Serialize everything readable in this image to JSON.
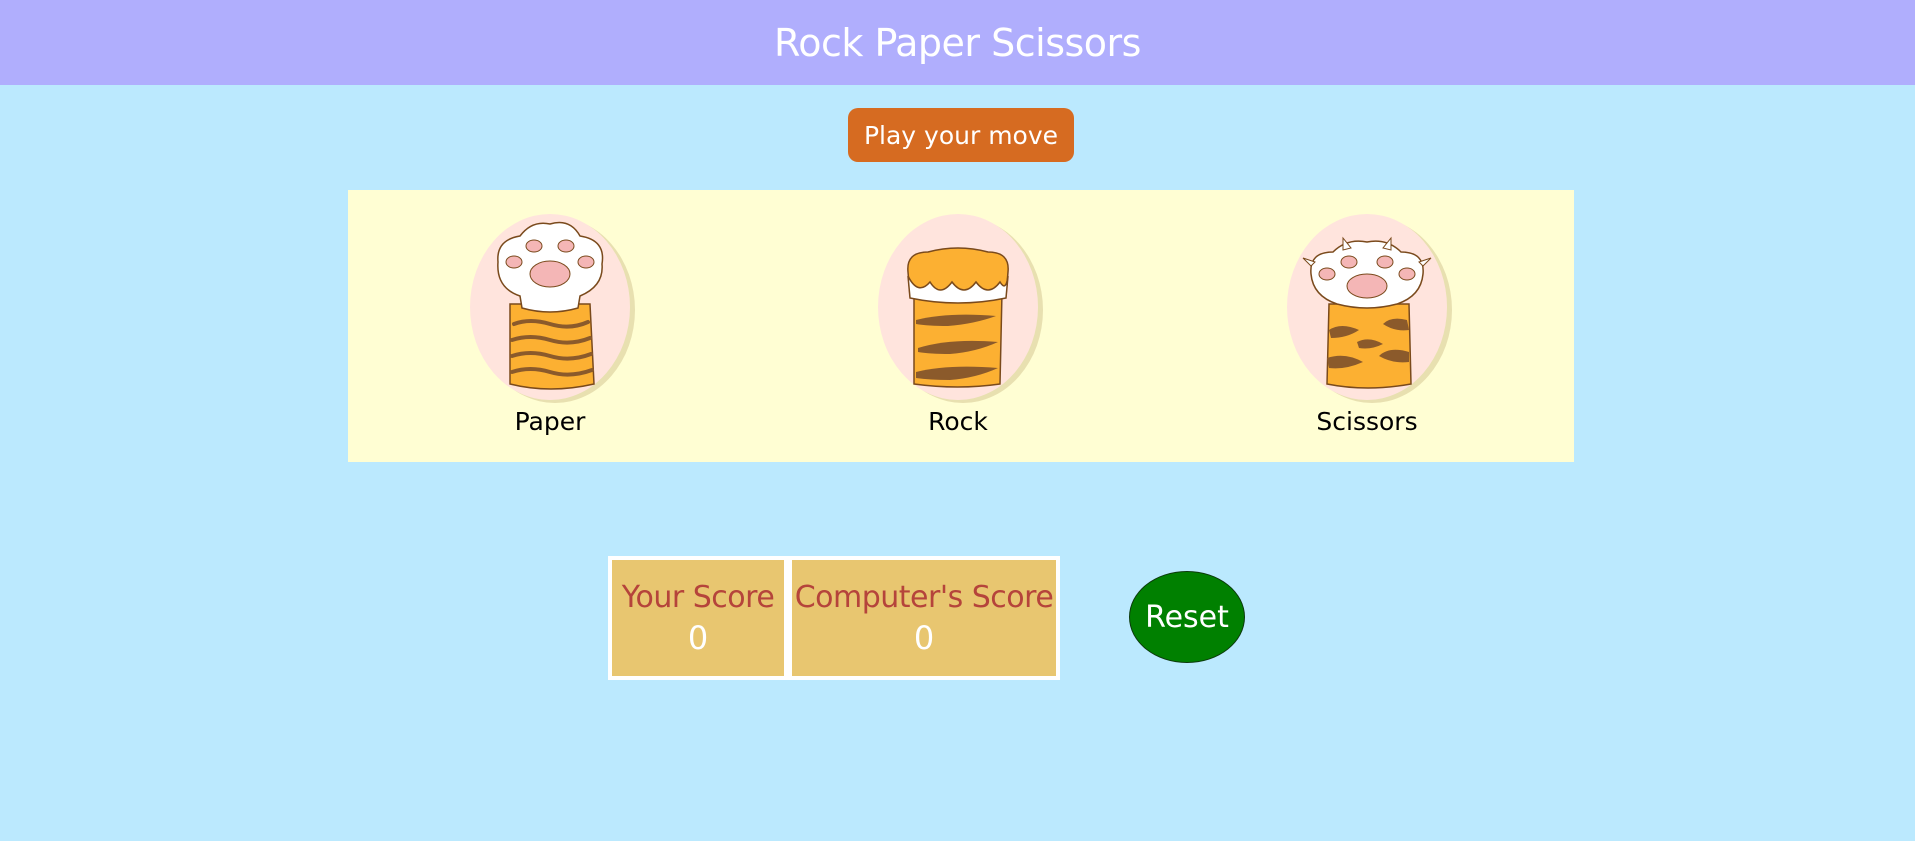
{
  "header": {
    "title": "Rock Paper Scissors"
  },
  "play_button": {
    "label": "Play your move"
  },
  "moves": [
    {
      "label": "Paper",
      "icon": "open-paw-icon"
    },
    {
      "label": "Rock",
      "icon": "closed-paw-icon"
    },
    {
      "label": "Scissors",
      "icon": "claw-paw-icon"
    }
  ],
  "scores": {
    "player": {
      "title": "Your Score",
      "value": "0"
    },
    "computer": {
      "title": "Computer's Score",
      "value": "0"
    }
  },
  "reset_button": {
    "label": "Reset"
  },
  "colors": {
    "page_bg": "#bbe9fe",
    "header_bg": "#b0aefd",
    "play_button": "#d66b21",
    "panel_bg": "#fffed3",
    "circle_bg": "#ffe4dd",
    "fur_orange": "#fcb032",
    "stripe_brown": "#8b5a2b",
    "paw_pad_pink": "#f4b6b6",
    "score_bg": "#e8c670",
    "score_title": "#b5443b",
    "reset_button": "#008000"
  }
}
